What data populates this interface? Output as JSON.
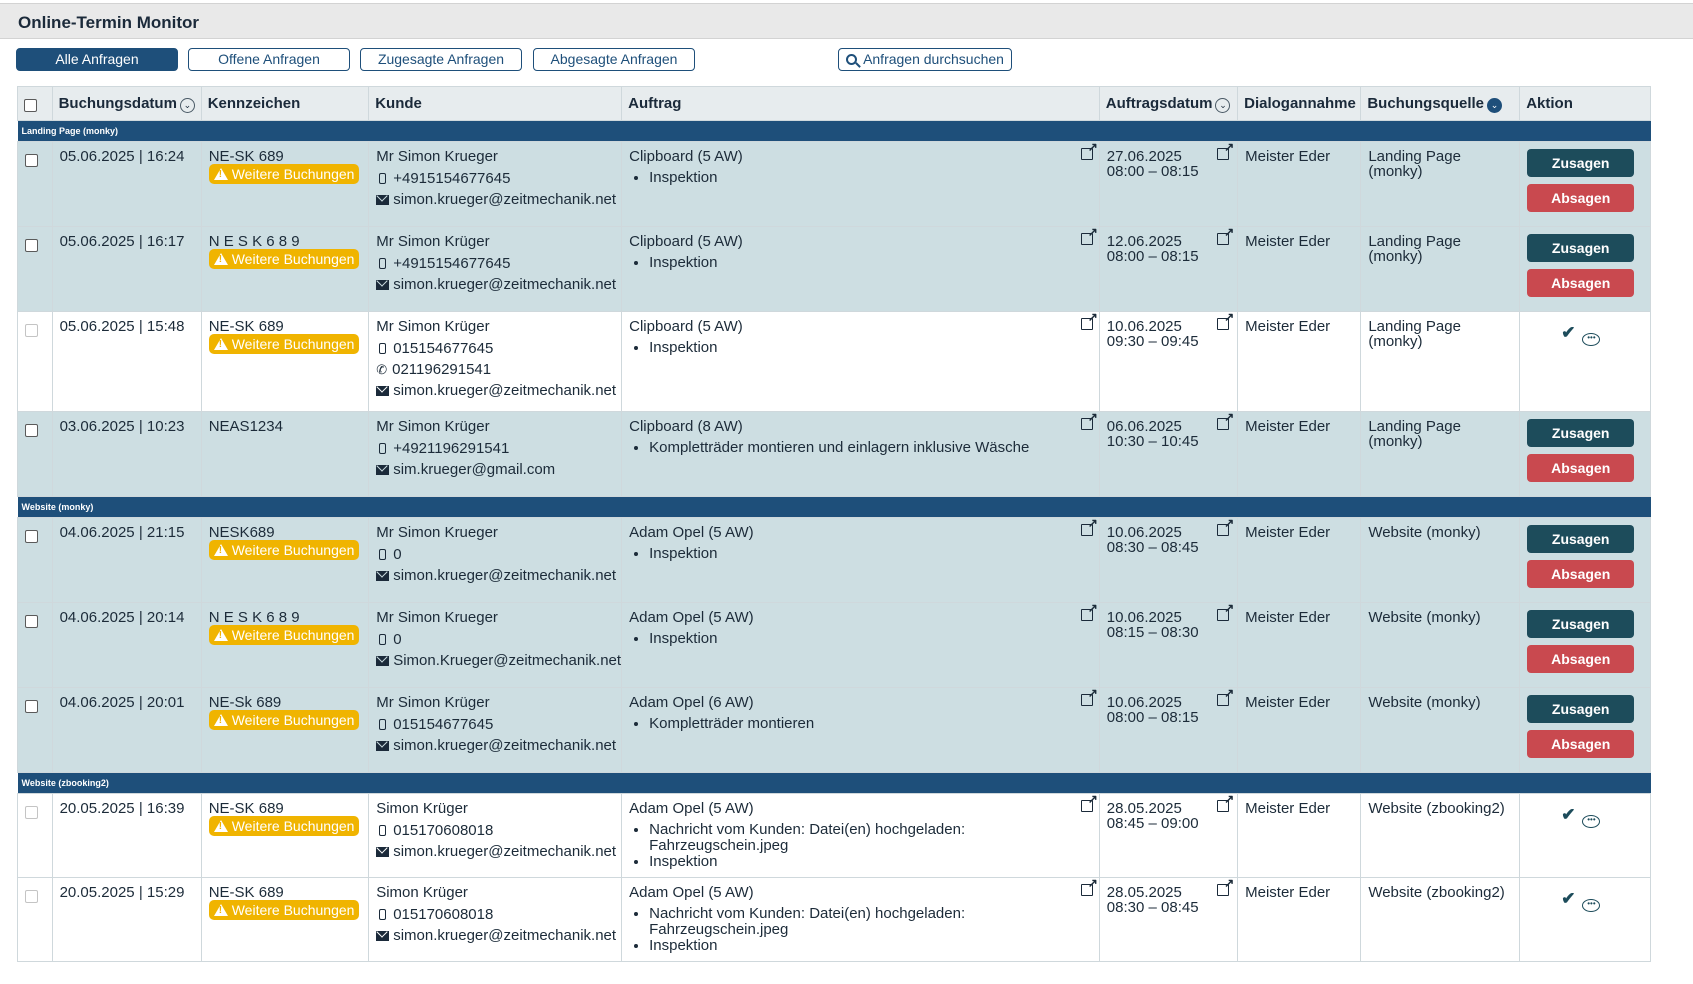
{
  "header": {
    "title": "Online-Termin Monitor"
  },
  "filters": [
    {
      "label": "Alle Anfragen",
      "active": true
    },
    {
      "label": "Offene Anfragen",
      "active": false
    },
    {
      "label": "Zugesagte Anfragen",
      "active": false
    },
    {
      "label": "Abgesagte Anfragen",
      "active": false
    }
  ],
  "search": {
    "label": "Anfragen durchsuchen"
  },
  "columns": {
    "buchungsdatum": "Buchungsdatum",
    "kennzeichen": "Kennzeichen",
    "kunde": "Kunde",
    "auftrag": "Auftrag",
    "auftragsdatum": "Auftragsdatum",
    "dialogannahme": "Dialogannahme",
    "buchungsquelle": "Buchungsquelle",
    "aktion": "Aktion"
  },
  "labels": {
    "badge": "Weitere Buchungen",
    "accept": "Zusagen",
    "reject": "Absagen"
  },
  "groups": [
    {
      "name": "Landing Page (monky)",
      "rows": [
        {
          "state": "pending",
          "booked": "05.06.2025 | 16:24",
          "plate": "NE-SK 689",
          "badge": true,
          "customer": "Mr Simon Krueger",
          "phone": "+4915154677645",
          "tel": "",
          "email": "simon.krueger@zeitmechanik.net",
          "order": "Clipboard (5 AW)",
          "items": [
            "Inspektion"
          ],
          "date": "27.06.2025",
          "time": "08:00 – 08:15",
          "agent": "Meister Eder",
          "source": "Landing Page (monky)"
        },
        {
          "state": "pending",
          "booked": "05.06.2025 | 16:17",
          "plate": "N E S K 6 8 9",
          "badge": true,
          "customer": "Mr Simon Krüger",
          "phone": "+4915154677645",
          "tel": "",
          "email": "simon.krueger@zeitmechanik.net",
          "order": "Clipboard (5 AW)",
          "items": [
            "Inspektion"
          ],
          "date": "12.06.2025",
          "time": "08:00 – 08:15",
          "agent": "Meister Eder",
          "source": "Landing Page (monky)"
        },
        {
          "state": "done",
          "booked": "05.06.2025 | 15:48",
          "plate": "NE-SK 689",
          "badge": true,
          "customer": "Mr Simon Krüger",
          "phone": "015154677645",
          "tel": "021196291541",
          "email": "simon.krueger@zeitmechanik.net",
          "order": "Clipboard (5 AW)",
          "items": [
            "Inspektion"
          ],
          "date": "10.06.2025",
          "time": "09:30 – 09:45",
          "agent": "Meister Eder",
          "source": "Landing Page (monky)"
        },
        {
          "state": "pending",
          "booked": "03.06.2025 | 10:23",
          "plate": "NEAS1234",
          "badge": false,
          "customer": "Mr Simon Krüger",
          "phone": "+4921196291541",
          "tel": "",
          "email": "sim.krueger@gmail.com",
          "order": "Clipboard (8 AW)",
          "items": [
            "Kompletträder montieren und einlagern inklusive Wäsche"
          ],
          "date": "06.06.2025",
          "time": "10:30 – 10:45",
          "agent": "Meister Eder",
          "source": "Landing Page (monky)"
        }
      ]
    },
    {
      "name": "Website (monky)",
      "rows": [
        {
          "state": "pending",
          "booked": "04.06.2025 | 21:15",
          "plate": "NESK689",
          "badge": true,
          "customer": "Mr Simon Krueger",
          "phone": "0",
          "tel": "",
          "email": "simon.krueger@zeitmechanik.net",
          "order": "Adam Opel (5 AW)",
          "items": [
            "Inspektion"
          ],
          "date": "10.06.2025",
          "time": "08:30 – 08:45",
          "agent": "Meister Eder",
          "source": "Website (monky)"
        },
        {
          "state": "pending",
          "booked": "04.06.2025 | 20:14",
          "plate": "N E S K 6 8 9",
          "badge": true,
          "customer": "Mr Simon Krueger",
          "phone": "0",
          "tel": "",
          "email": "Simon.Krueger@zeitmechanik.net",
          "order": "Adam Opel (5 AW)",
          "items": [
            "Inspektion"
          ],
          "date": "10.06.2025",
          "time": "08:15 – 08:30",
          "agent": "Meister Eder",
          "source": "Website (monky)"
        },
        {
          "state": "pending",
          "booked": "04.06.2025 | 20:01",
          "plate": "NE-Sk 689",
          "badge": true,
          "customer": "Mr Simon Krüger",
          "phone": "015154677645",
          "tel": "",
          "email": "simon.krueger@zeitmechanik.net",
          "order": "Adam Opel (6 AW)",
          "items": [
            "Kompletträder montieren"
          ],
          "date": "10.06.2025",
          "time": "08:00 – 08:15",
          "agent": "Meister Eder",
          "source": "Website (monky)"
        }
      ]
    },
    {
      "name": "Website (zbooking2)",
      "rows": [
        {
          "state": "done",
          "booked": "20.05.2025 | 16:39",
          "plate": "NE-SK 689",
          "badge": true,
          "customer": "Simon Krüger",
          "phone": "015170608018",
          "tel": "",
          "email": "simon.krueger@zeitmechanik.net",
          "order": "Adam Opel (5 AW)",
          "items": [
            "Nachricht vom Kunden: Datei(en) hochgeladen: Fahrzeugschein.jpeg",
            "Inspektion"
          ],
          "date": "28.05.2025",
          "time": "08:45 – 09:00",
          "agent": "Meister Eder",
          "source": "Website (zbooking2)"
        },
        {
          "state": "done",
          "booked": "20.05.2025 | 15:29",
          "plate": "NE-SK 689",
          "badge": true,
          "customer": "Simon Krüger",
          "phone": "015170608018",
          "tel": "",
          "email": "simon.krueger@zeitmechanik.net",
          "order": "Adam Opel (5 AW)",
          "items": [
            "Nachricht vom Kunden: Datei(en) hochgeladen: Fahrzeugschein.jpeg",
            "Inspektion"
          ],
          "date": "28.05.2025",
          "time": "08:30 – 08:45",
          "agent": "Meister Eder",
          "source": "Website (zbooking2)"
        }
      ]
    }
  ],
  "colors": {
    "primary": "#1e4f7a",
    "pending_row": "#cddee2",
    "badge": "#f0b400",
    "accept": "#1d4c5b",
    "reject": "#c9494f"
  }
}
